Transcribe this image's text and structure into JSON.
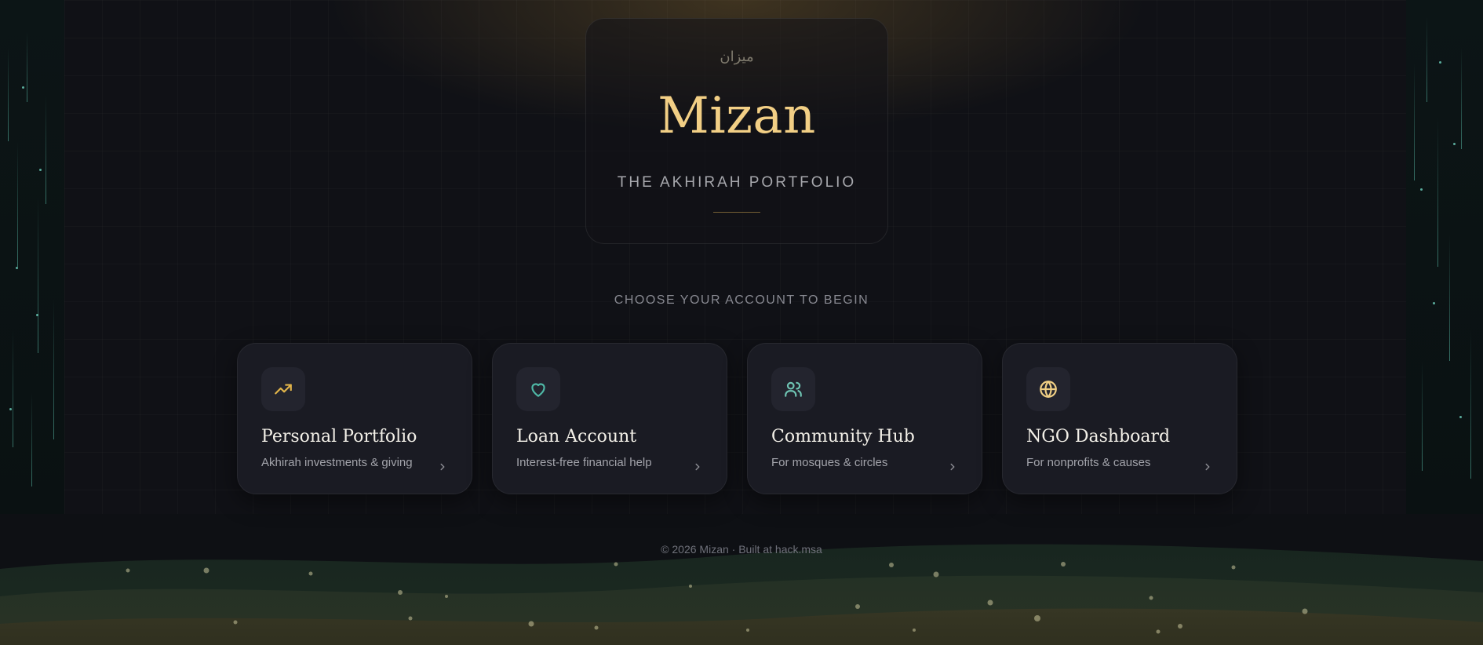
{
  "hero": {
    "arabic_title": "ميزان",
    "brand_name": "Mizan",
    "tagline": "THE AKHIRAH PORTFOLIO"
  },
  "prompt": "CHOOSE YOUR ACCOUNT TO BEGIN",
  "accounts": [
    {
      "title": "Personal Portfolio",
      "subtitle": "Akhirah investments & giving",
      "icon": "trending-up-icon",
      "icon_color": "#e2b54a"
    },
    {
      "title": "Loan Account",
      "subtitle": "Interest-free financial help",
      "icon": "heart-icon",
      "icon_color": "#4fb8a6"
    },
    {
      "title": "Community Hub",
      "subtitle": "For mosques & circles",
      "icon": "users-icon",
      "icon_color": "#6fc4b3"
    },
    {
      "title": "NGO Dashboard",
      "subtitle": "For nonprofits & causes",
      "icon": "globe-icon",
      "icon_color": "#f0cf84"
    }
  ],
  "footer": {
    "copyright": "© 2026 Mizan · Built at hack.msa"
  },
  "colors": {
    "accent_gold": "#f2cf85",
    "card_bg": "#1a1b23",
    "page_bg": "#101116"
  }
}
